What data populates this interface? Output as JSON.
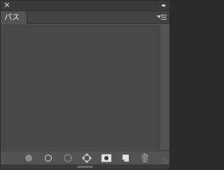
{
  "panel": {
    "close_glyph": "✕",
    "collapse_glyph": "◂◂",
    "tab_label": "パス",
    "menu_icon": "panel-menu-icon"
  },
  "toolbar": {
    "buttons": [
      {
        "name": "fill-path-button",
        "icon": "filled-circle-icon"
      },
      {
        "name": "stroke-path-button",
        "icon": "circle-outline-icon"
      },
      {
        "name": "load-selection-button",
        "icon": "dotted-circle-icon"
      },
      {
        "name": "make-work-path-button",
        "icon": "path-anchor-icon"
      },
      {
        "name": "add-mask-button",
        "icon": "mask-icon"
      },
      {
        "name": "new-path-button",
        "icon": "new-page-icon"
      },
      {
        "name": "delete-path-button",
        "icon": "trash-icon"
      }
    ]
  }
}
